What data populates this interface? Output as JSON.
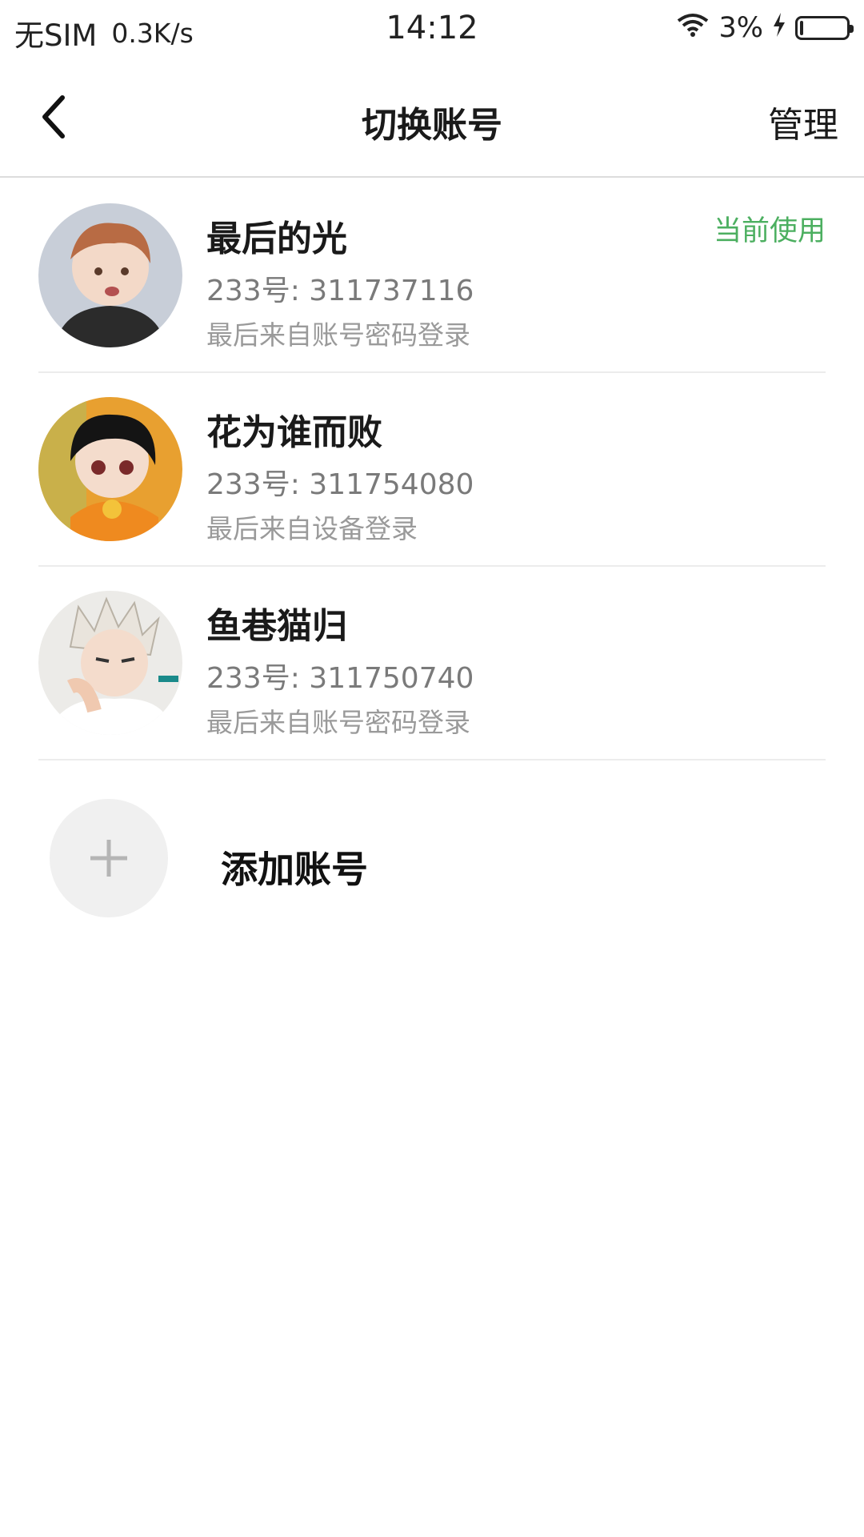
{
  "status_bar": {
    "carrier": "无SIM",
    "speed": "0.3K/s",
    "time": "14:12",
    "battery": "3%"
  },
  "nav": {
    "title": "切换账号",
    "manage": "管理"
  },
  "accounts": [
    {
      "name": "最后的光",
      "id": "233号: 311737116",
      "login": "最后来自账号密码登录",
      "badge": "当前使用"
    },
    {
      "name": "花为谁而败",
      "id": "233号: 311754080",
      "login": "最后来自设备登录"
    },
    {
      "name": "鱼巷猫归",
      "id": "233号: 311750740",
      "login": "最后来自账号密码登录"
    }
  ],
  "add_account": {
    "label": "添加账号"
  },
  "colors": {
    "accent_green": "#4caf60",
    "divider": "#dcdcdc"
  },
  "icons": {
    "back": "chevron-left-icon",
    "wifi": "wifi-icon",
    "charging": "bolt-icon",
    "battery": "battery-icon",
    "add": "plus-icon"
  }
}
